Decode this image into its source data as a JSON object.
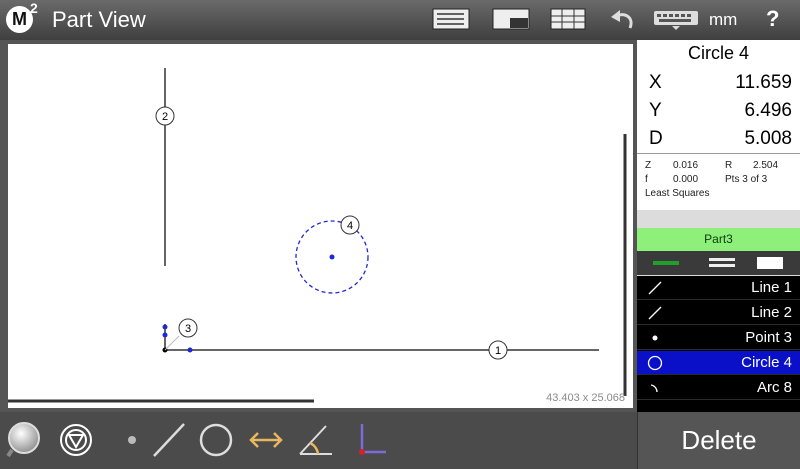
{
  "header": {
    "logo_letter": "M",
    "logo_sup": "2",
    "title": "Part View",
    "units": "mm",
    "help": "?"
  },
  "view": {
    "dimensions": "43.403 x 25.068",
    "markers": [
      "1",
      "2",
      "3",
      "4"
    ]
  },
  "readout": {
    "feature": "Circle 4",
    "rows": [
      {
        "axis": "X",
        "value": "11.659"
      },
      {
        "axis": "Y",
        "value": "6.496"
      },
      {
        "axis": "D",
        "value": "5.008"
      }
    ],
    "z_label": "Z",
    "z_value": "0.016",
    "r_label": "R",
    "r_value": "2.504",
    "f_label": "f",
    "f_value": "0.000",
    "pts": "Pts 3 of 3",
    "method": "Least Squares"
  },
  "part": {
    "name": "Part3"
  },
  "features": [
    {
      "label": "Line 1",
      "icon": "line-icon",
      "selected": false
    },
    {
      "label": "Line 2",
      "icon": "line-icon",
      "selected": false
    },
    {
      "label": "Point 3",
      "icon": "point-icon",
      "selected": false
    },
    {
      "label": "Circle 4",
      "icon": "circle-icon",
      "selected": true
    },
    {
      "label": "Arc 8",
      "icon": "arc-icon",
      "selected": false
    }
  ],
  "bottom": {
    "delete_label": "Delete"
  },
  "colors": {
    "selected": "#0a10c8",
    "part_bar": "#8ef07a",
    "circle": "#1a2ad8"
  }
}
